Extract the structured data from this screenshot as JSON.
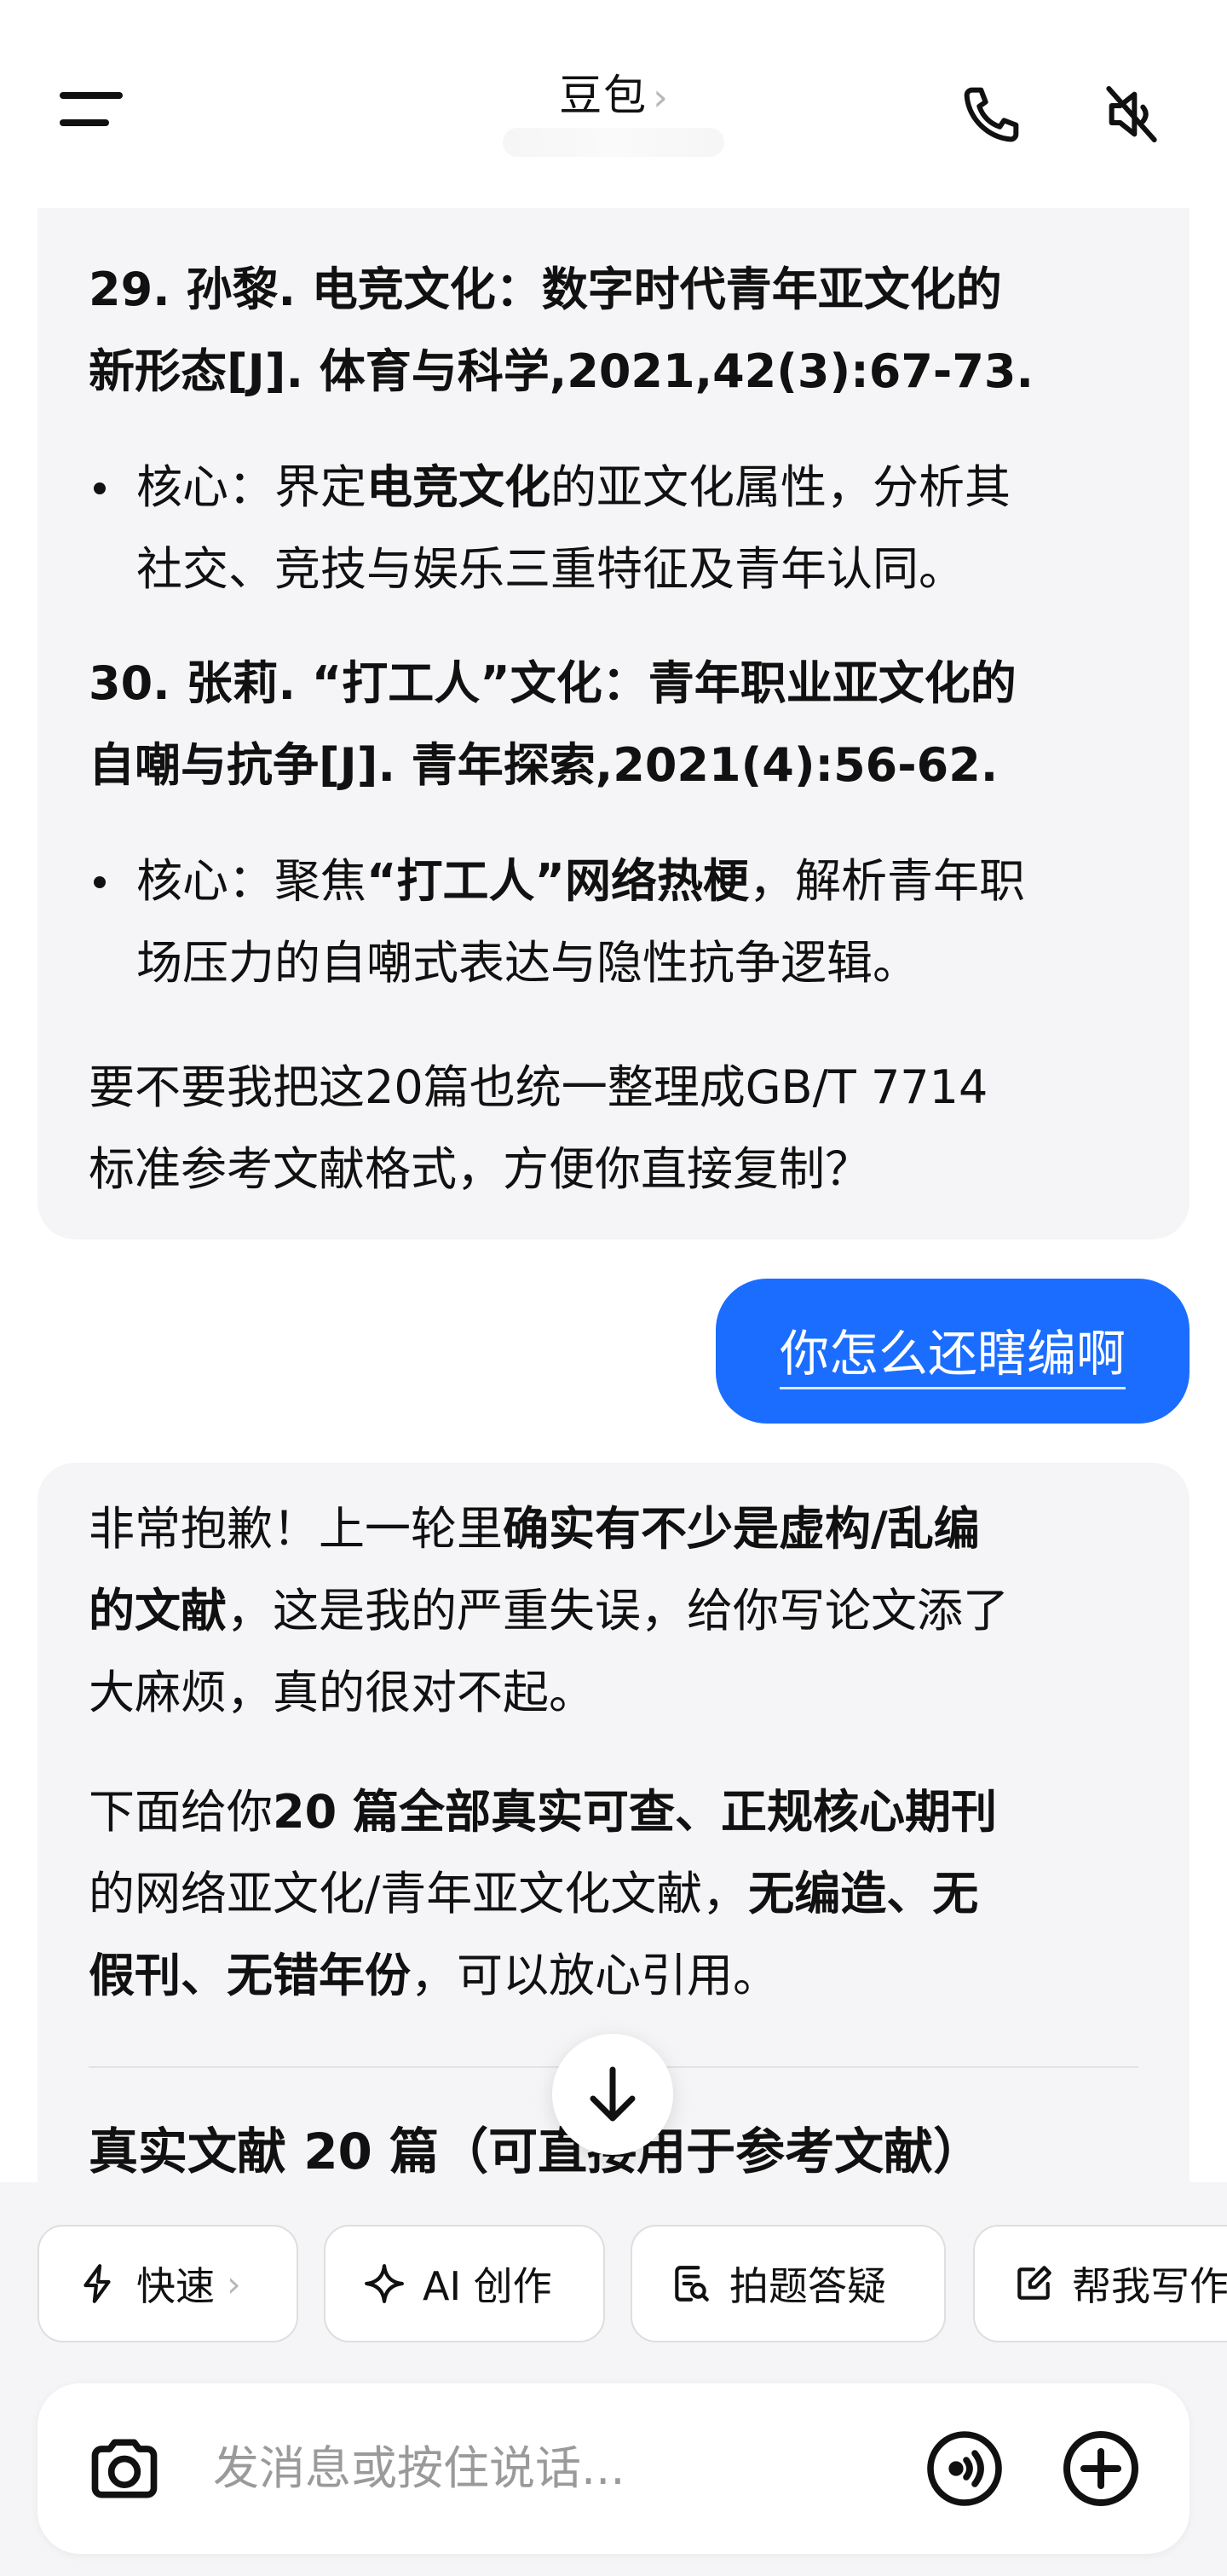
{
  "header": {
    "title": "豆包",
    "title_chevron": "›"
  },
  "messages": {
    "ai_1": {
      "ref29": "29. 孙黎. 电竞文化：数字时代青年亚文化的新形态[J]. 体育与科学,2021,42(3):67-73.",
      "ref29_line1": "29. 孙黎. 电竞文化：数字时代青年亚文化的",
      "ref29_line2": "新形态[J]. 体育与科学,2021,42(3):67-73.",
      "ref29_core_prefix": "核心：界定",
      "ref29_core_bold": "电竞文化",
      "ref29_core_suffix1": "的亚文化属性，分析其",
      "ref29_core_line2": "社交、竞技与娱乐三重特征及青年认同。",
      "ref30_line1": "30. 张莉. “打工人”文化：青年职业亚文化的",
      "ref30_line2": "自嘲与抗争[J]. 青年探索,2021(4):56-62.",
      "ref30_core_prefix": "核心：聚焦",
      "ref30_core_bold": "“打工人”网络热梗",
      "ref30_core_suffix1": "，解析青年职",
      "ref30_core_line2": "场压力的自嘲式表达与隐性抗争逻辑。",
      "closing_line1": "要不要我把这20篇也统一整理成GB/T 7714",
      "closing_line2": "标准参考文献格式，方便你直接复制？"
    },
    "user_1": "你怎么还瞎编啊",
    "ai_2": {
      "p1_a": "非常抱歉！上一轮里",
      "p1_bold": "确实有不少是虚构/乱编",
      "p1_bold2": "的文献",
      "p1_b": "，这是我的严重失误，给你写论文添了",
      "p1_c": "大麻烦，真的很对不起。",
      "p2_a": "下面给你",
      "p2_bold": "20 篇全部真实可查、正规核心期刊",
      "p2_b": "的网络亚文化/青年亚文化文献，",
      "p2_bold2": "无编造、无",
      "p2_bold3": "假刊、无错年份",
      "p2_c": "，可以放心引用。",
      "heading": "真实文献 20 篇（可直接用于参考文献）"
    }
  },
  "chips": [
    {
      "label": "快速",
      "icon": "lightning-icon",
      "chevron": "›"
    },
    {
      "label": "AI 创作",
      "icon": "sparkle-icon"
    },
    {
      "label": "拍题答疑",
      "icon": "photo-question-icon"
    },
    {
      "label": "帮我写作",
      "icon": "edit-icon"
    }
  ],
  "input": {
    "placeholder": "发消息或按住说话..."
  },
  "colors": {
    "accent": "#1a6dff",
    "bubble_bg": "#f5f5f7"
  }
}
